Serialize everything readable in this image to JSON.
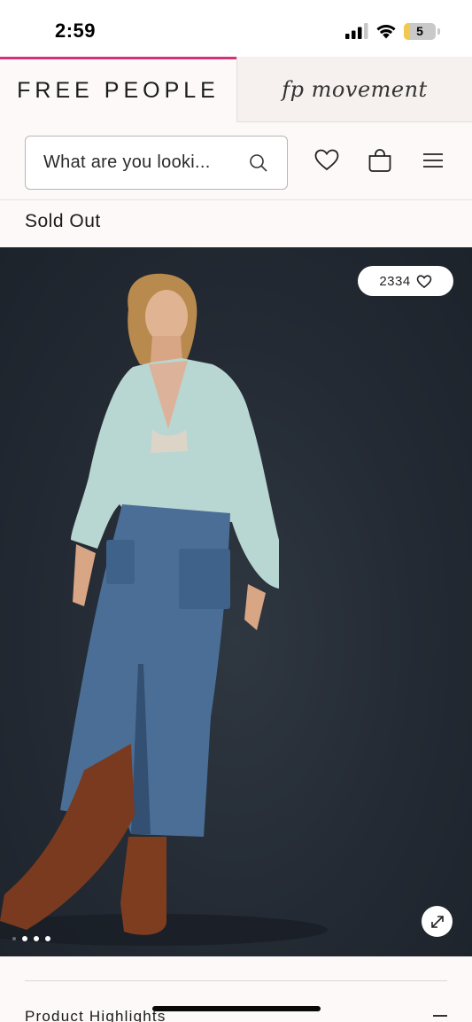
{
  "status_bar": {
    "time": "2:59",
    "battery": "5"
  },
  "brands": {
    "active": "FREE PEOPLE",
    "inactive": "fp movement"
  },
  "search": {
    "placeholder": "What are you looki..."
  },
  "product": {
    "availability": "Sold Out",
    "likes": "2334"
  },
  "gallery": {
    "images_visible": 3,
    "current_index": 1
  },
  "sections": {
    "highlights_label": "Product Highlights"
  },
  "colors": {
    "accent": "#d6317a",
    "image_bg": "#232a33",
    "page_bg": "#fcf9f8"
  }
}
